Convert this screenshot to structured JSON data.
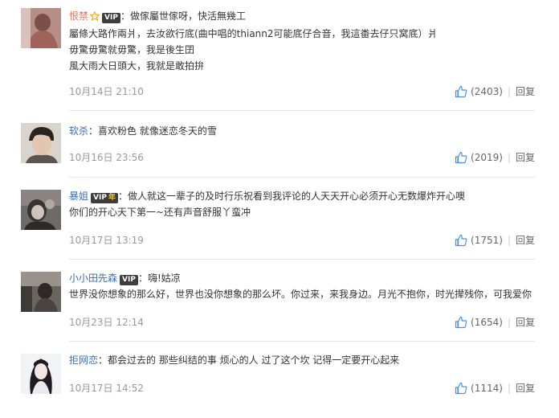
{
  "comments": [
    {
      "user": "恨禁",
      "has_star": true,
      "vip": "VIP",
      "vip_year": "",
      "lines": [
        "：做傢屬世傢呀，快活無幾工",
        "屬條大路作兩爿，去汝欲行底(曲中唱的thiann2可能底仔合音，我這畨去仔只窝底）爿",
        "毋驚毋驚就毋驚，我是後生囝",
        "風大雨大日頭大，我就是敢拍拚"
      ],
      "time": "10月14日 21:10",
      "likes": "(2403)",
      "reply": "回复"
    },
    {
      "user": "软杀",
      "has_star": false,
      "vip": "",
      "vip_year": "",
      "lines": [
        "：喜欢粉色 就像迷恋冬天的雪"
      ],
      "time": "10月16日 23:56",
      "likes": "(2019)",
      "reply": "回复"
    },
    {
      "user": "暴姐",
      "has_star": false,
      "vip": "VIP",
      "vip_year": "年",
      "lines": [
        "：做人就这一辈子的及时行乐祝看到我评论的人天天开心必须开心无数爆炸开心噢",
        "你们的开心天下第一~还有声音舒服丫蛮冲"
      ],
      "time": "10月17日 13:19",
      "likes": "(1751)",
      "reply": "回复"
    },
    {
      "user": "小小田先森",
      "has_star": false,
      "vip": "VIP",
      "vip_year": "",
      "lines": [
        "：嗨!姑凉",
        "世界没你想象的那么好，世界也没你想象的那么坏。你过来，来我身边。月光不抱你，时光撵残你，可我爱你"
      ],
      "time": "10月23日 12:14",
      "likes": "(1654)",
      "reply": "回复"
    },
    {
      "user": "拒网恋",
      "has_star": false,
      "vip": "",
      "vip_year": "",
      "lines": [
        "：都会过去的 那些纠结的事 烦心的人 过了这个坎 记得一定要开心起来"
      ],
      "time": "10月17日 14:52",
      "likes": "(1114)",
      "reply": "回复"
    }
  ],
  "separator": "|",
  "colors": {
    "username": "#3a6fb0",
    "username_alt": "#eb7350",
    "meta": "#999999",
    "like_icon": "#4a90d9"
  }
}
